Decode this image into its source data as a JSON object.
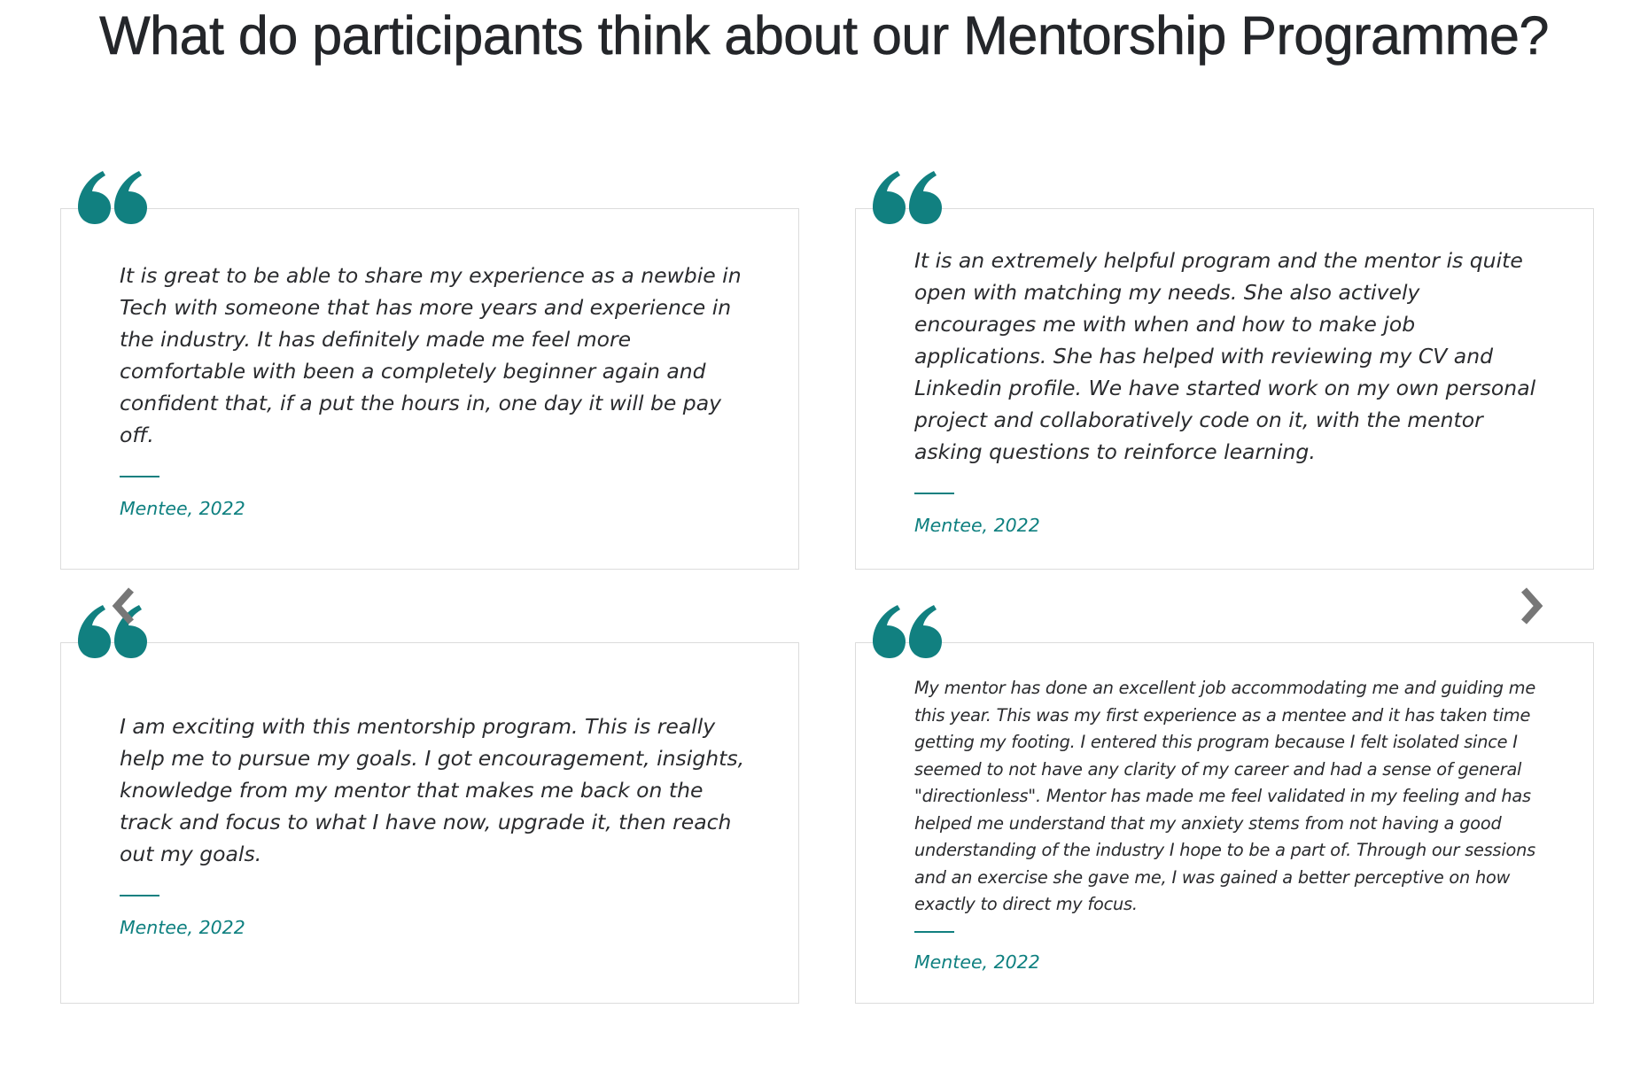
{
  "page": {
    "title": "What do participants think about our Mentorship Programme?"
  },
  "colors": {
    "accent": "#118080",
    "arrow": "#777777",
    "card_border": "#dcdcdc",
    "text": "#2a2b2e"
  },
  "icons": {
    "quote": "quote-icon",
    "prev": "chevron-left-icon",
    "next": "chevron-right-icon"
  },
  "testimonials": [
    {
      "text": "It is great to be able to share my experience as a newbie in Tech with someone that has more years and experience in the industry. It has definitely made me feel more comfortable with been a completely beginner again and confident that, if a put the hours in, one day it will be pay off.",
      "author": "Mentee, 2022"
    },
    {
      "text": "It is an extremely helpful program and the mentor is quite open with matching my needs. She also actively encourages me with when and how to make job applications. She has helped with reviewing my CV and Linkedin profile. We have started work on my own personal project and collaboratively code on it, with the mentor asking questions to reinforce learning.",
      "author": "Mentee, 2022"
    },
    {
      "text": "I am exciting with this mentorship program. This is really help me to pursue my goals. I got encouragement, insights, knowledge from my mentor that makes me back on the track and focus to what I have now, upgrade it, then reach out my goals.",
      "author": "Mentee, 2022"
    },
    {
      "text": "My mentor has done an excellent job accommodating me and guiding me this year. This was my first experience as a mentee and it has taken time getting my footing. I entered this program because I felt isolated since I seemed to not have any clarity of my career and had a sense of general \"directionless\". Mentor has made me feel validated in my feeling and has helped me understand that my anxiety stems from not having a good understanding of the industry I hope to be a part of. Through our sessions and an exercise she gave me, I was gained a better perceptive on how exactly to direct my focus.",
      "author": "Mentee, 2022"
    }
  ]
}
